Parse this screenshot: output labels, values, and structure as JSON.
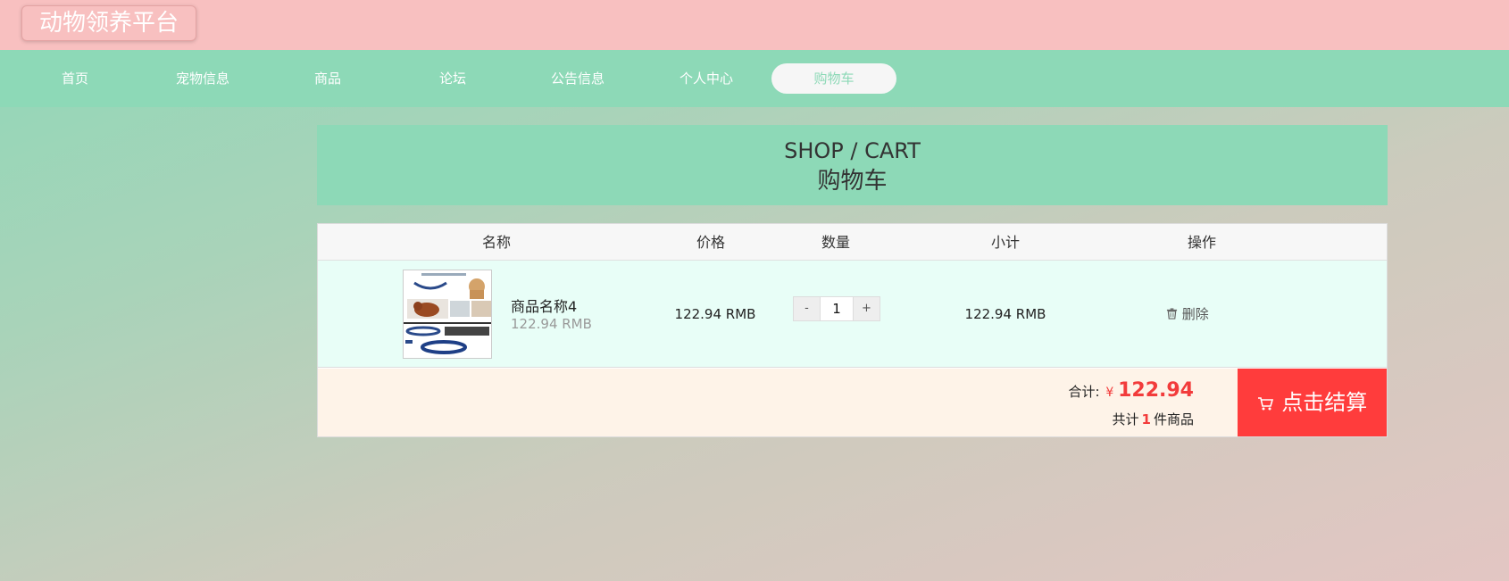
{
  "app": {
    "title": "动物领养平台"
  },
  "nav": {
    "items": [
      {
        "label": "首页"
      },
      {
        "label": "宠物信息"
      },
      {
        "label": "商品"
      },
      {
        "label": "论坛"
      },
      {
        "label": "公告信息"
      },
      {
        "label": "个人中心"
      },
      {
        "label": "购物车"
      }
    ],
    "active_index": 6
  },
  "cart_header": {
    "title_en": "SHOP / CART",
    "title_zh": "购物车"
  },
  "table": {
    "headers": [
      "名称",
      "价格",
      "数量",
      "小计",
      "操作"
    ],
    "rows": [
      {
        "name": "商品名称4",
        "unit_price_label": "122.94 RMB",
        "price": "122.94 RMB",
        "quantity": "1",
        "subtotal": "122.94 RMB",
        "action_label": "删除",
        "action_icon": "trash-icon"
      }
    ]
  },
  "quantity_controls": {
    "minus": "-",
    "plus": "+"
  },
  "summary": {
    "total_label": "合计:",
    "currency": "¥",
    "total_amount": "122.94",
    "count_prefix": "共计",
    "count": "1",
    "count_suffix": "件商品"
  },
  "checkout": {
    "label": "点击结算",
    "icon": "cart-icon"
  },
  "colors": {
    "topbar": "#f8c0c0",
    "navbar": "#8dd9b7",
    "accent_red": "#ff3c3c",
    "row_bg": "#e8fef7",
    "footer_bg": "#fef3e8"
  }
}
